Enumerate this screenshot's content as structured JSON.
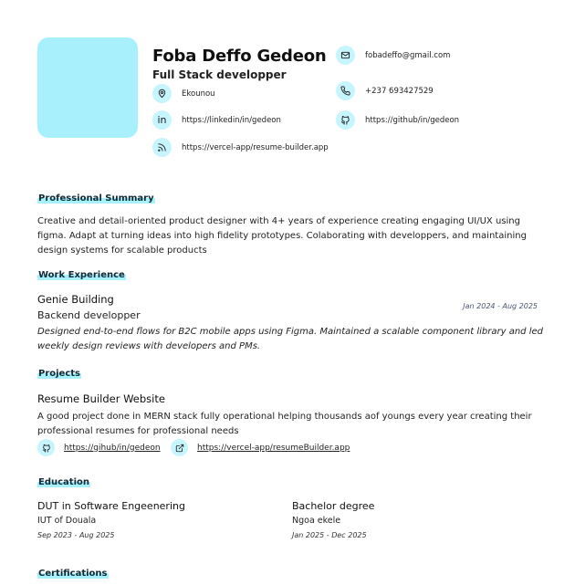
{
  "header": {
    "name": "Foba Deffo Gedeon",
    "role": "Full Stack developper",
    "email": "fobadeffo@gmail.com",
    "location": "Ekounou",
    "phone": "+237 693427529",
    "linkedin": "https://linkedin/in/gedeon",
    "github": "https://github/in/gedeon",
    "website": "https://vercel-app/resume-builder.app"
  },
  "summary": {
    "title": "Professional Summary",
    "text": "Creative and detail-oriented product designer with 4+ years of experience creating engaging UI/UX using figma. Adapt at turning ideas into high fidelity prototypes. Colaborating with developpers, and maintaining design systems for scalable products"
  },
  "work": {
    "title": "Work Experience",
    "company": "Genie Building",
    "position": "Backend developper",
    "dates": "Jan 2024 - Aug 2025",
    "description": "Designed end-to-end flows for B2C mobile apps using Figma. Maintained a scalable component library and led weekly design reviews with developers and PMs."
  },
  "projects": {
    "title": "Projects",
    "name": "Resume Builder Website",
    "description": "A good project done in MERN stack fully operational helping thousands aof youngs every year creating their professional resumes for professional needs",
    "repo_link": "https://gihub/in/gedeon",
    "live_link": "https://vercel-app/resumeBuilder.app"
  },
  "education": {
    "title": "Education",
    "items": [
      {
        "degree": "DUT in Software Engeenering",
        "school": "IUT of Douala",
        "dates": "Sep 2023 - Aug 2025"
      },
      {
        "degree": "Bachelor degree",
        "school": "Ngoa ekele",
        "dates": "Jan 2025 - Dec 2025"
      }
    ]
  },
  "certifications": {
    "title": "Certifications"
  },
  "icons": {
    "email": "mail-icon",
    "location": "map-pin-icon",
    "phone": "phone-icon",
    "linkedin": "linkedin-icon",
    "github": "github-icon",
    "website": "rss-icon",
    "live": "external-link-icon"
  },
  "colors": {
    "accent": "#a8f0fc",
    "icon_bg": "#c6f5fd"
  }
}
